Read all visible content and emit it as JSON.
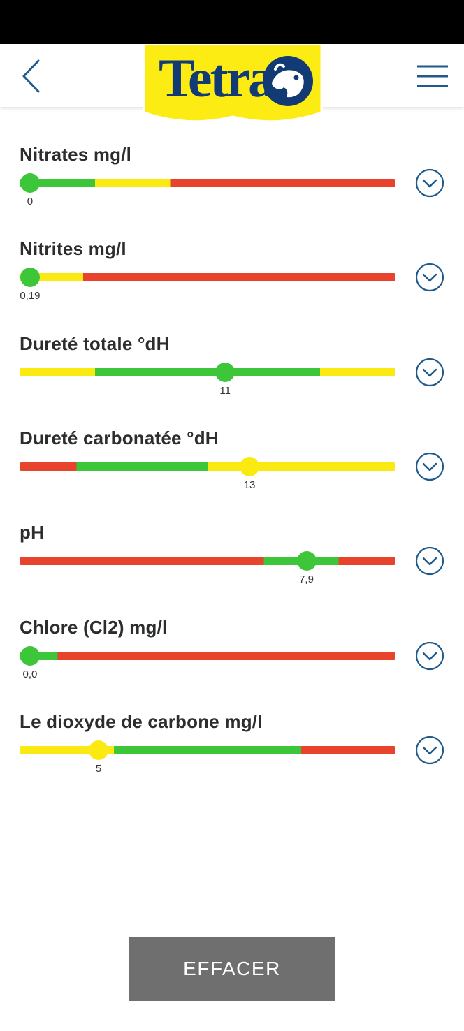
{
  "app": {
    "logo_text": "Tetra"
  },
  "colors": {
    "green": "#3ec63a",
    "yellow": "#fbea12",
    "red": "#e8432c",
    "icon_blue": "#1f5a8b",
    "button_gray": "#6f6f6f"
  },
  "parameters": [
    {
      "title": "Nitrates mg/l",
      "value_label": "0",
      "level": 0.026,
      "thumb_color": "green",
      "segments": [
        {
          "color": "green",
          "from": 0.0,
          "to": 0.2
        },
        {
          "color": "yellow",
          "from": 0.2,
          "to": 0.4
        },
        {
          "color": "red",
          "from": 0.4,
          "to": 1.0
        }
      ]
    },
    {
      "title": "Nitrites mg/l",
      "value_label": "0,19",
      "level": 0.026,
      "thumb_color": "green",
      "segments": [
        {
          "color": "yellow",
          "from": 0.0,
          "to": 0.168
        },
        {
          "color": "red",
          "from": 0.168,
          "to": 1.0
        }
      ]
    },
    {
      "title": "Dureté totale °dH",
      "value_label": "11",
      "level": 0.547,
      "thumb_color": "green",
      "segments": [
        {
          "color": "yellow",
          "from": 0.0,
          "to": 0.2
        },
        {
          "color": "green",
          "from": 0.2,
          "to": 0.8
        },
        {
          "color": "yellow",
          "from": 0.8,
          "to": 1.0
        }
      ]
    },
    {
      "title": "Dureté carbonatée °dH",
      "value_label": "13",
      "level": 0.612,
      "thumb_color": "yellow",
      "segments": [
        {
          "color": "red",
          "from": 0.0,
          "to": 0.15
        },
        {
          "color": "green",
          "from": 0.15,
          "to": 0.5
        },
        {
          "color": "yellow",
          "from": 0.5,
          "to": 1.0
        }
      ]
    },
    {
      "title": "pH",
      "value_label": "7,9",
      "level": 0.764,
      "thumb_color": "green",
      "segments": [
        {
          "color": "red",
          "from": 0.0,
          "to": 0.65
        },
        {
          "color": "green",
          "from": 0.65,
          "to": 0.85
        },
        {
          "color": "red",
          "from": 0.85,
          "to": 1.0
        }
      ]
    },
    {
      "title": "Chlore (Cl2) mg/l",
      "value_label": "0,0",
      "level": 0.026,
      "thumb_color": "green",
      "segments": [
        {
          "color": "green",
          "from": 0.0,
          "to": 0.1
        },
        {
          "color": "red",
          "from": 0.1,
          "to": 1.0
        }
      ]
    },
    {
      "title": "Le dioxyde de carbone mg/l",
      "value_label": "5",
      "level": 0.209,
      "thumb_color": "yellow",
      "segments": [
        {
          "color": "yellow",
          "from": 0.0,
          "to": 0.25
        },
        {
          "color": "green",
          "from": 0.25,
          "to": 0.75
        },
        {
          "color": "red",
          "from": 0.75,
          "to": 1.0
        }
      ]
    }
  ],
  "icons": {
    "back": "chevron-left-icon",
    "menu": "hamburger-menu-icon",
    "expand": "chevron-down-circle-icon",
    "logo_mark": "fish-icon"
  },
  "clear_button": {
    "label": "EFFACER"
  }
}
